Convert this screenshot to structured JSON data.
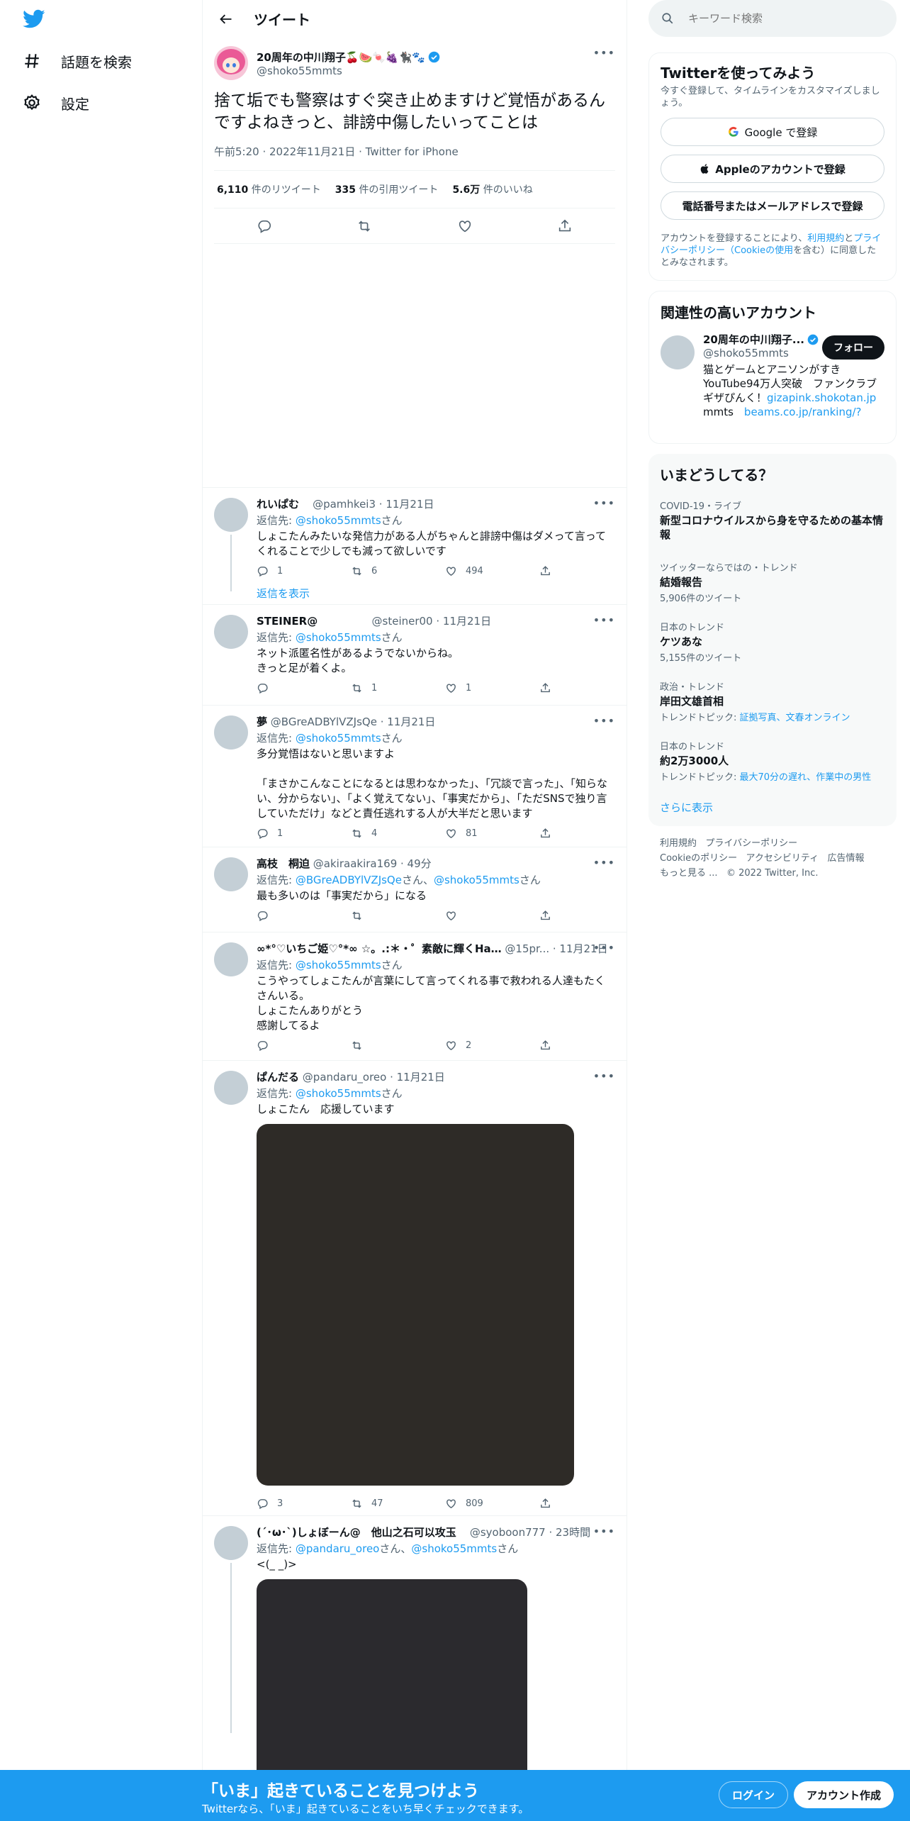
{
  "nav": {
    "explore_label": "話題を検索",
    "settings_label": "設定"
  },
  "header": {
    "title": "ツイート"
  },
  "focal": {
    "author_name": "20周年の中川翔子🍒🍉🍬🍇🐈‍⬛🐾",
    "author_handle": "@shoko55mmts",
    "text": "捨て垢でも警察はすぐ突き止めますけど覚悟があるんですよねきっと、誹謗中傷したいってことは",
    "meta": "午前5:20 · 2022年11月21日 · Twitter for iPhone",
    "retweets_num": "6,110",
    "retweets_label": "件のリツイート",
    "quotes_num": "335",
    "quotes_label": "件の引用ツイート",
    "likes_num": "5.6万",
    "likes_label": "件のいいね"
  },
  "replies": [
    {
      "name": "れいぱむ",
      "meta": "@pamhkei3 · 11月21日",
      "reply_prefix": "返信先: ",
      "reply_to": "@shoko55mmts",
      "reply_suffix": "さん",
      "text": "しょこたんみたいな発信力がある人がちゃんと誹謗中傷はダメって言ってくれることで少しでも減って欲しいです",
      "replies": "1",
      "retweets": "6",
      "likes": "494",
      "show_replies": "返信を表示"
    },
    {
      "name": "STEINER@",
      "meta": "@steiner00 · 11月21日",
      "reply_prefix": "返信先: ",
      "reply_to": "@shoko55mmts",
      "reply_suffix": "さん",
      "text": "ネット派匿名性があるようでないからね。\nきっと足が着くよ。",
      "replies": "",
      "retweets": "1",
      "likes": "1"
    },
    {
      "name": "夢",
      "meta": "@BGreADBYlVZJsQe · 11月21日",
      "reply_prefix": "返信先: ",
      "reply_to": "@shoko55mmts",
      "reply_suffix": "さん",
      "text": "多分覚悟はないと思いますよ\n\n「まさかこんなことになるとは思わなかった」、「冗談で言った」、「知らない、分からない」、「よく覚えてない」、「事実だから」、「ただSNSで独り言していただけ」などと責任逃れする人が大半だと思います",
      "replies": "1",
      "retweets": "4",
      "likes": "81"
    },
    {
      "name": "高枝　桐迫",
      "meta": "@akiraakira169 · 49分",
      "reply_prefix": "返信先: ",
      "reply_to": "@BGreADBYlVZJsQe",
      "reply_mid": "さん、",
      "reply_to2": "@shoko55mmts",
      "reply_suffix": "さん",
      "text": "最も多いのは「事実だから」になる",
      "replies": "",
      "retweets": "",
      "likes": ""
    },
    {
      "name": "∞*°♡いちご姫♡°*∞ ☆。.:＊・゜素敵に輝くHa…",
      "meta": "@15pr... · 11月21日",
      "reply_prefix": "返信先: ",
      "reply_to": "@shoko55mmts",
      "reply_suffix": "さん",
      "text": "こうやってしょこたんが言葉にして言ってくれる事で救われる人達もたくさんいる。\nしょこたんありがとう\n感謝してるよ",
      "replies": "",
      "retweets": "",
      "likes": "2"
    },
    {
      "name": "ぱんだる",
      "meta": "@pandaru_oreo · 11月21日",
      "reply_prefix": "返信先: ",
      "reply_to": "@shoko55mmts",
      "reply_suffix": "さん",
      "text": "しょこたん　応援しています",
      "replies": "3",
      "retweets": "47",
      "likes": "809"
    },
    {
      "name": "(´･ω･`)しょぼーん@　他山之石可以攻玉",
      "meta": "@syoboon777 · 23時間",
      "reply_prefix": "返信先: ",
      "reply_to": "@pandaru_oreo",
      "reply_mid": "さん、",
      "reply_to2": "@shoko55mmts",
      "reply_suffix": "さん",
      "text": "<(_ _)>"
    }
  ],
  "right": {
    "search_placeholder": "キーワード検索",
    "signup_card": {
      "title": "Twitterを使ってみよう",
      "subtitle": "今すぐ登録して、タイムラインをカスタマイズしましょう。",
      "google_label": "Google で登録",
      "apple_label": "Appleのアカウントで登録",
      "phone_label": "電話番号またはメールアドレスで登録",
      "legal_1": "アカウントを登録することにより、",
      "legal_link1": "利用規約",
      "legal_2": "と",
      "legal_link2": "プライバシーポリシー（Cookieの使用",
      "legal_3": "を含む）に同意したとみなされます。"
    },
    "relevant": {
      "title": "関連性の高いアカウント",
      "name": "20周年の中川翔子...",
      "handle": "@shoko55mmts",
      "follow_label": "フォロー",
      "bio_1": "猫とゲームとアニソンがすき　YouTube94万人突破　ファンクラブギザぴんく！",
      "bio_link1": "gizapink.shokotan.jp",
      "bio_2": "mmts　",
      "bio_link2": "beams.co.jp/ranking/?label",
      "bio_3": "..."
    },
    "trends": {
      "title": "いまどうしてる？",
      "items": [
        {
          "context": "COVID-19・ライブ",
          "title": "新型コロナウイルスから身を守るための基本情報",
          "count": ""
        },
        {
          "context": "ツイッターならではの・トレンド",
          "title": "結婚報告",
          "count": "5,906件のツイート"
        },
        {
          "context": "日本のトレンド",
          "title": "ケツあな",
          "count": "5,155件のツイート"
        },
        {
          "context": "政治・トレンド",
          "title": "岸田文雄首相",
          "count_prefix": "トレンドトピック: ",
          "count_link": "証拠写真、文春オンライン"
        },
        {
          "context": "日本のトレンド",
          "title": "約2万3000人",
          "count_prefix": "トレンドトピック: ",
          "count_link": "最大70分の遅れ、作業中の男性"
        }
      ],
      "show_more": "さらに表示"
    },
    "footer": {
      "l1a": "利用規約",
      "l1b": "プライバシーポリシー",
      "l2a": "Cookieのポリシー",
      "l2b": "アクセシビリティ",
      "l2c": "広告情報",
      "l3a": "もっと見る ...",
      "l3b": "© 2022 Twitter, Inc."
    }
  },
  "bottom_bar": {
    "headline": "「いま」起きていることを見つけよう",
    "sub": "Twitterなら、「いま」起きていることをいち早くチェックできます。",
    "login_label": "ログイン",
    "signup_label": "アカウント作成"
  },
  "colors": {
    "brand": "#1d9bf0",
    "text": "#0f1419",
    "secondary": "#536471"
  }
}
